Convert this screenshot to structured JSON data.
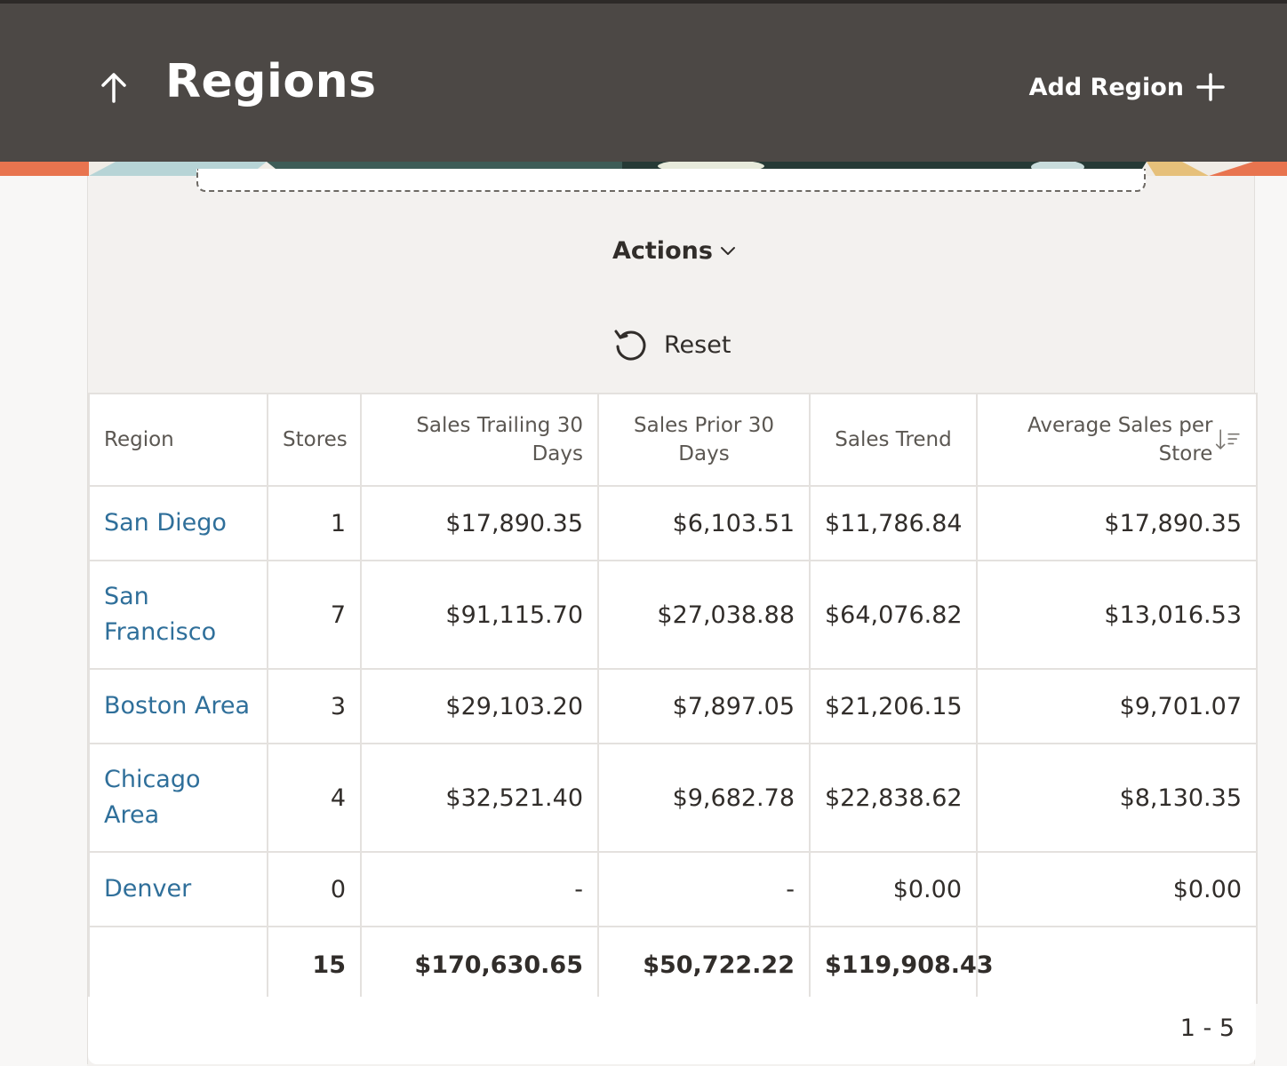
{
  "header": {
    "title": "Regions",
    "add_label": "Add Region"
  },
  "toolbar": {
    "actions_label": "Actions",
    "reset_label": "Reset"
  },
  "table": {
    "columns": [
      "Region",
      "Stores",
      "Sales Trailing 30 Days",
      "Sales Prior 30 Days",
      "Sales Trend",
      "Average Sales per Store"
    ],
    "rows": [
      {
        "region": "San Diego",
        "stores": "1",
        "trailing": "$17,890.35",
        "prior": "$6,103.51",
        "trend": "$11,786.84",
        "avg": "$17,890.35"
      },
      {
        "region": "San Francisco",
        "stores": "7",
        "trailing": "$91,115.70",
        "prior": "$27,038.88",
        "trend": "$64,076.82",
        "avg": "$13,016.53"
      },
      {
        "region": "Boston Area",
        "stores": "3",
        "trailing": "$29,103.20",
        "prior": "$7,897.05",
        "trend": "$21,206.15",
        "avg": "$9,701.07"
      },
      {
        "region": "Chicago Area",
        "stores": "4",
        "trailing": "$32,521.40",
        "prior": "$9,682.78",
        "trend": "$22,838.62",
        "avg": "$8,130.35"
      },
      {
        "region": "Denver",
        "stores": "0",
        "trailing": "-",
        "prior": "-",
        "trend": "$0.00",
        "avg": "$0.00"
      }
    ],
    "totals": {
      "stores": "15",
      "trailing": "$170,630.65",
      "prior": "$50,722.22",
      "trend": "$119,908.43"
    }
  },
  "pagination": {
    "range": "1 - 5"
  },
  "colors": {
    "header_bg": "#4c4845",
    "link": "#2f6f9a",
    "accent_orange": "#e8744f"
  },
  "icons": [
    "arrow-up-icon",
    "plus-icon",
    "chevron-down-icon",
    "reset-icon",
    "sort-descending-icon"
  ]
}
